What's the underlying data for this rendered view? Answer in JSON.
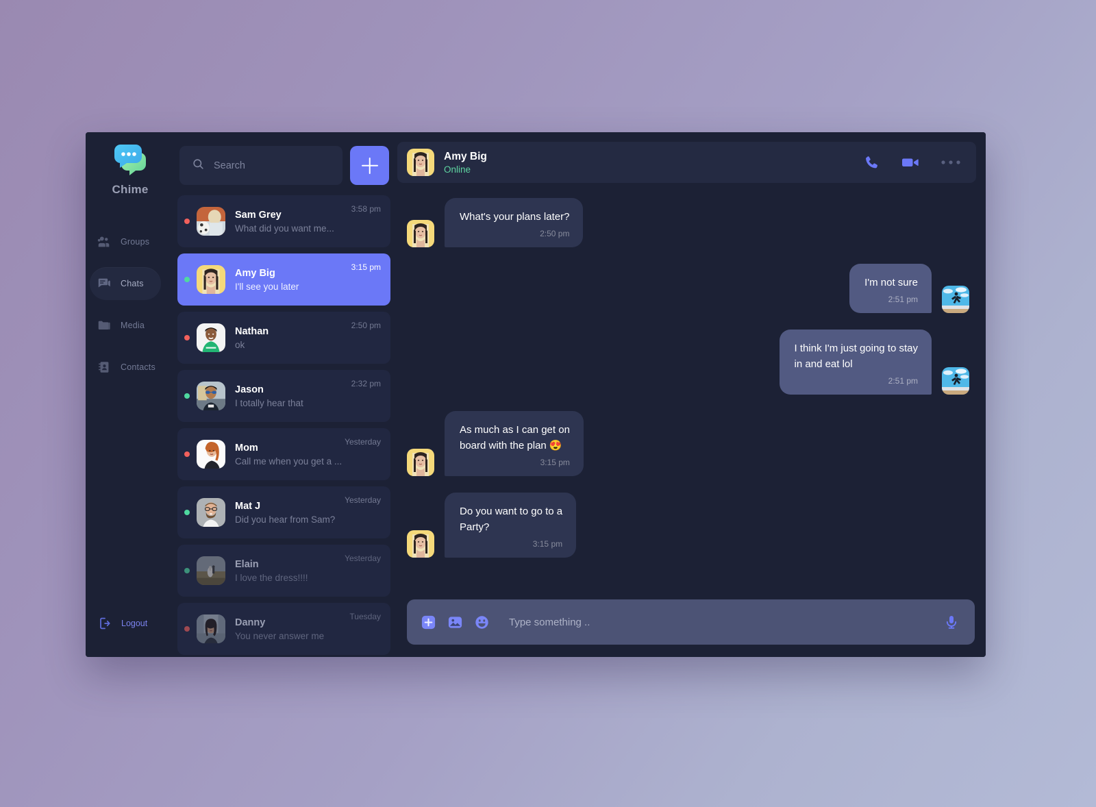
{
  "brand": {
    "name": "Chime",
    "logo_icon": "chat-bubbles-logo"
  },
  "nav": {
    "items": [
      {
        "label": "Groups",
        "icon": "people-group-icon",
        "active": false
      },
      {
        "label": "Chats",
        "icon": "chat-bubble-icon",
        "active": true
      },
      {
        "label": "Media",
        "icon": "folder-icon",
        "active": false
      },
      {
        "label": "Contacts",
        "icon": "contact-book-icon",
        "active": false
      }
    ],
    "logout": {
      "label": "Logout",
      "icon": "logout-icon"
    }
  },
  "search": {
    "placeholder": "Search",
    "value": "",
    "icon": "search-icon"
  },
  "new_chat": {
    "icon": "plus-icon",
    "label": ""
  },
  "chat_list": [
    {
      "name": "Sam Grey",
      "preview": "What did you want me...",
      "time": "3:58 pm",
      "presence": "offline",
      "selected": false,
      "dim": false,
      "avatar": "woman-with-dalmatian-photo"
    },
    {
      "name": "Amy Big",
      "preview": "I'll see you later",
      "time": "3:15 pm",
      "presence": "online",
      "selected": true,
      "dim": false,
      "avatar": "woman-yellow-background-photo"
    },
    {
      "name": "Nathan",
      "preview": "ok",
      "time": "2:50 pm",
      "presence": "offline",
      "selected": false,
      "dim": false,
      "avatar": "man-green-shirt-photo"
    },
    {
      "name": "Jason",
      "preview": "I totally hear that",
      "time": "2:32 pm",
      "presence": "online",
      "selected": false,
      "dim": false,
      "avatar": "man-sunglasses-photo"
    },
    {
      "name": "Mom",
      "preview": "Call me when you get a ...",
      "time": "Yesterday",
      "presence": "offline",
      "selected": false,
      "dim": false,
      "avatar": "woman-red-hair-photo"
    },
    {
      "name": "Mat J",
      "preview": "Did you hear from Sam?",
      "time": "Yesterday",
      "presence": "online",
      "selected": false,
      "dim": false,
      "avatar": "man-glasses-grey-photo"
    },
    {
      "name": "Elain",
      "preview": "I love the dress!!!!",
      "time": "Yesterday",
      "presence": "online",
      "selected": false,
      "dim": true,
      "avatar": "couple-in-field-photo"
    },
    {
      "name": "Danny",
      "preview": "You never answer me",
      "time": "Tuesday",
      "presence": "offline",
      "selected": false,
      "dim": true,
      "avatar": "woman-city-street-photo"
    }
  ],
  "conversation": {
    "contact_name": "Amy Big",
    "status": "Online",
    "avatar": "woman-yellow-background-photo",
    "actions": [
      {
        "name": "voice-call",
        "icon": "phone-icon"
      },
      {
        "name": "video-call",
        "icon": "video-camera-icon"
      },
      {
        "name": "more-options",
        "icon": "ellipsis-icon"
      }
    ],
    "messages": [
      {
        "direction": "incoming",
        "text": "What's your plans later?",
        "time": "2:50 pm",
        "avatar": "woman-yellow-background-photo"
      },
      {
        "direction": "outgoing",
        "text": "I'm not sure",
        "time": "2:51 pm",
        "avatar": "person-jumping-beach-photo"
      },
      {
        "direction": "outgoing",
        "text": "I think I'm just going to stay\nin and eat lol",
        "time": "2:51 pm",
        "avatar": "person-jumping-beach-photo"
      },
      {
        "direction": "incoming",
        "text": "As much as I can get on\nboard with the plan 😍",
        "time": "3:15 pm",
        "avatar": "woman-yellow-background-photo"
      },
      {
        "direction": "incoming",
        "text": "Do you want to go to a\nParty?",
        "time": "3:15 pm",
        "avatar": "woman-yellow-background-photo"
      }
    ]
  },
  "composer": {
    "placeholder": "Type something ..",
    "value": "",
    "icons": [
      {
        "name": "add-attachment",
        "icon": "plus-square-icon"
      },
      {
        "name": "send-image",
        "icon": "image-icon"
      },
      {
        "name": "emoji-picker",
        "icon": "smiley-icon"
      }
    ],
    "mic": {
      "name": "voice-record",
      "icon": "microphone-icon"
    }
  },
  "colors": {
    "accent": "#6b78f7",
    "window_bg": "#1c2135",
    "panel_bg": "#242a42",
    "bubble_incoming": "#2e3551",
    "bubble_outgoing": "#525a82",
    "online": "#4fd9a0",
    "offline": "#f2605c",
    "composer_bg": "#4c5375"
  }
}
